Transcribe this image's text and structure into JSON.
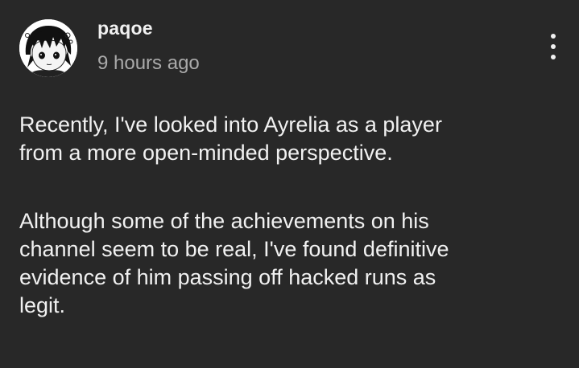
{
  "comment": {
    "author": "paqoe",
    "timestamp": "9 hours ago",
    "paragraphs": [
      "Recently, I've looked into Ayrelia as a player\nfrom a more open-minded perspective.",
      "Although some of the achievements on his\nchannel seem to be real, I've found definitive\nevidence of him passing off hacked runs as\nlegit."
    ]
  },
  "icons": {
    "avatar": "anime-character-avatar",
    "menu": "more-vert-icon"
  },
  "colors": {
    "background": "#282828",
    "text_primary": "#f1f1f1",
    "text_secondary": "#aaaaaa"
  }
}
